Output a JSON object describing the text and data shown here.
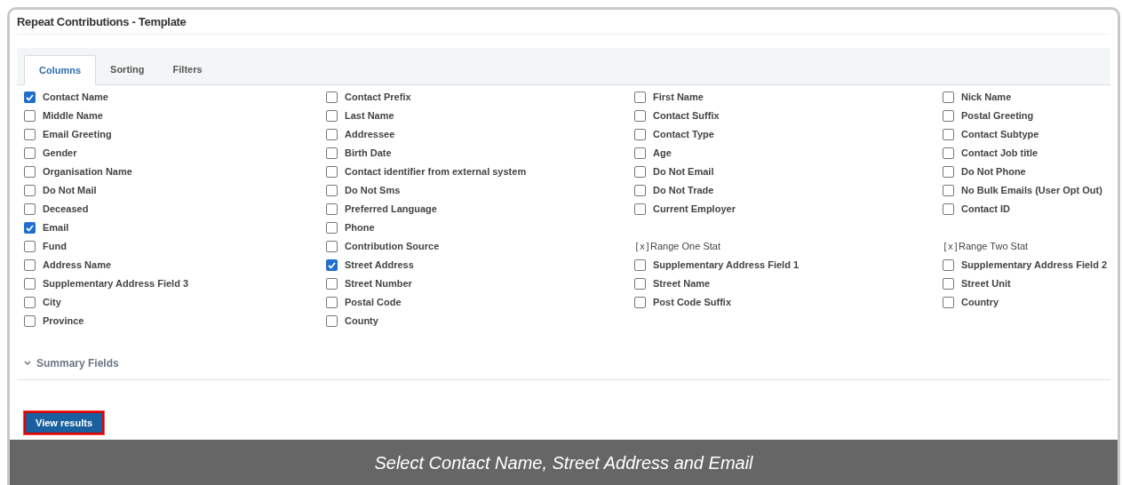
{
  "title": "Repeat Contributions - Template",
  "tabs": [
    {
      "label": "Columns",
      "selected": true
    },
    {
      "label": "Sorting",
      "selected": false
    },
    {
      "label": "Filters",
      "selected": false
    }
  ],
  "rows": [
    [
      {
        "kind": "checkbox",
        "label": "Contact Name",
        "checked": true
      },
      {
        "kind": "checkbox",
        "label": "Contact Prefix",
        "checked": false
      },
      {
        "kind": "checkbox",
        "label": "First Name",
        "checked": false
      },
      {
        "kind": "checkbox",
        "label": "Nick Name",
        "checked": false
      }
    ],
    [
      {
        "kind": "checkbox",
        "label": "Middle Name",
        "checked": false
      },
      {
        "kind": "checkbox",
        "label": "Last Name",
        "checked": false
      },
      {
        "kind": "checkbox",
        "label": "Contact Suffix",
        "checked": false
      },
      {
        "kind": "checkbox",
        "label": "Postal Greeting",
        "checked": false
      }
    ],
    [
      {
        "kind": "checkbox",
        "label": "Email Greeting",
        "checked": false
      },
      {
        "kind": "checkbox",
        "label": "Addressee",
        "checked": false
      },
      {
        "kind": "checkbox",
        "label": "Contact Type",
        "checked": false
      },
      {
        "kind": "checkbox",
        "label": "Contact Subtype",
        "checked": false
      }
    ],
    [
      {
        "kind": "checkbox",
        "label": "Gender",
        "checked": false
      },
      {
        "kind": "checkbox",
        "label": "Birth Date",
        "checked": false
      },
      {
        "kind": "checkbox",
        "label": "Age",
        "checked": false
      },
      {
        "kind": "checkbox",
        "label": "Contact Job title",
        "checked": false
      }
    ],
    [
      {
        "kind": "checkbox",
        "label": "Organisation Name",
        "checked": false
      },
      {
        "kind": "checkbox",
        "label": "Contact identifier from external system",
        "checked": false
      },
      {
        "kind": "checkbox",
        "label": "Do Not Email",
        "checked": false
      },
      {
        "kind": "checkbox",
        "label": "Do Not Phone",
        "checked": false
      }
    ],
    [
      {
        "kind": "checkbox",
        "label": "Do Not Mail",
        "checked": false
      },
      {
        "kind": "checkbox",
        "label": "Do Not Sms",
        "checked": false
      },
      {
        "kind": "checkbox",
        "label": "Do Not Trade",
        "checked": false
      },
      {
        "kind": "checkbox",
        "label": "No Bulk Emails (User Opt Out)",
        "checked": false
      }
    ],
    [
      {
        "kind": "checkbox",
        "label": "Deceased",
        "checked": false
      },
      {
        "kind": "checkbox",
        "label": "Preferred Language",
        "checked": false
      },
      {
        "kind": "checkbox",
        "label": "Current Employer",
        "checked": false
      },
      {
        "kind": "checkbox",
        "label": "Contact ID",
        "checked": false
      }
    ],
    [
      {
        "kind": "checkbox",
        "label": "Email",
        "checked": true
      },
      {
        "kind": "checkbox",
        "label": "Phone",
        "checked": false
      }
    ],
    [
      {
        "kind": "checkbox",
        "label": "Fund",
        "checked": false
      },
      {
        "kind": "checkbox",
        "label": "Contribution Source",
        "checked": false
      },
      {
        "kind": "stat",
        "marker": "[x]",
        "label": "Range One Stat"
      },
      {
        "kind": "stat",
        "marker": "[x]",
        "label": "Range Two Stat"
      }
    ],
    [
      {
        "kind": "checkbox",
        "label": "Address Name",
        "checked": false
      },
      {
        "kind": "checkbox",
        "label": "Street Address",
        "checked": true
      },
      {
        "kind": "checkbox",
        "label": "Supplementary Address Field 1",
        "checked": false
      },
      {
        "kind": "checkbox",
        "label": "Supplementary Address Field 2",
        "checked": false
      }
    ],
    [
      {
        "kind": "checkbox",
        "label": "Supplementary Address Field 3",
        "checked": false
      },
      {
        "kind": "checkbox",
        "label": "Street Number",
        "checked": false
      },
      {
        "kind": "checkbox",
        "label": "Street Name",
        "checked": false
      },
      {
        "kind": "checkbox",
        "label": "Street Unit",
        "checked": false
      }
    ],
    [
      {
        "kind": "checkbox",
        "label": "City",
        "checked": false
      },
      {
        "kind": "checkbox",
        "label": "Postal Code",
        "checked": false
      },
      {
        "kind": "checkbox",
        "label": "Post Code Suffix",
        "checked": false
      },
      {
        "kind": "checkbox",
        "label": "Country",
        "checked": false
      }
    ],
    [
      {
        "kind": "checkbox",
        "label": "Province",
        "checked": false
      },
      {
        "kind": "checkbox",
        "label": "County",
        "checked": false
      }
    ]
  ],
  "summary": {
    "label": "Summary Fields",
    "expanded": false
  },
  "button": "View results",
  "caption": "Select Contact Name, Street Address and Email"
}
